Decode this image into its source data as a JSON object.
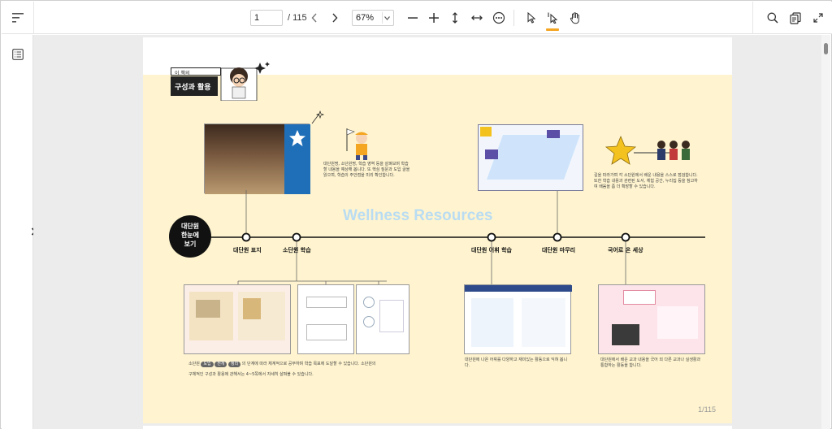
{
  "toolbar": {
    "page_input": "1",
    "page_total": "/ 115",
    "zoom": "67%"
  },
  "icons": {
    "sidebar_toggle": "sidebar-toggle-icon",
    "prev": "chevron-left-icon",
    "next": "chevron-right-icon",
    "zoom_out": "minus-icon",
    "zoom_in": "plus-icon",
    "fit_height": "fit-height-icon",
    "fit_width": "fit-width-icon",
    "more": "more-icon",
    "select": "pointer-icon",
    "text_select": "text-cursor-icon",
    "hand": "hand-icon",
    "search": "search-icon",
    "copy": "copy-icon",
    "fullscreen": "fullscreen-icon",
    "outline": "outline-list-icon",
    "expand_side": "chevron-right-icon"
  },
  "colors": {
    "accent": "#f4a521",
    "band": "#fff4cf",
    "watermark": "#b9dcf2"
  },
  "document": {
    "header_tag": "이 책의",
    "header_title": "구성과 활용",
    "circle_text": "대단원\n한눈에\n보기",
    "watermark": "Wellness Resources",
    "timeline_labels": [
      "대단원 표지",
      "소단원 학습",
      "대단원 어휘 학습",
      "대단원 마무리",
      "국어로 온 세상"
    ],
    "desc_top_left": "대단원명, 소단원명, 학습 영역 등을 살펴보며 학습할 내용을 예상해 봅니다. 또 핵심 질문과 도입 글을 읽으며, 학습의 주안점을 미리 확인합니다.",
    "desc_top_right": "길을 따라가며 각 소단원에서 배운 내용을 스스로 점검합니다. 또한 학습 내용과 관련된 도서, 체험 공간, 누리집 등을 참고하여 배움을 좀 더 확장할 수 있습니다.",
    "desc_bottom_left_1": "소단원",
    "chips": [
      "도입",
      "전개",
      "정리"
    ],
    "desc_bottom_left_2": "의 단계에 따라 체계적으로 공부하며 학습 목표에 도달할 수 있습니다. 소단원의",
    "desc_bottom_left_3": "구체적인 구성과 활용에 관해서는 4~5쪽에서 자세히 살펴볼 수 있습니다.",
    "desc_bottom_mid": "대단원에 나온 어휘를 다양하고 재미있는 활동으로 익혀 봅니다.",
    "desc_bottom_right": "대단원에서 배운 교과 내용을 국어 외 다른 교과나 실생활과 통합하는 활동을 합니다.",
    "page_footer": "1/115"
  }
}
